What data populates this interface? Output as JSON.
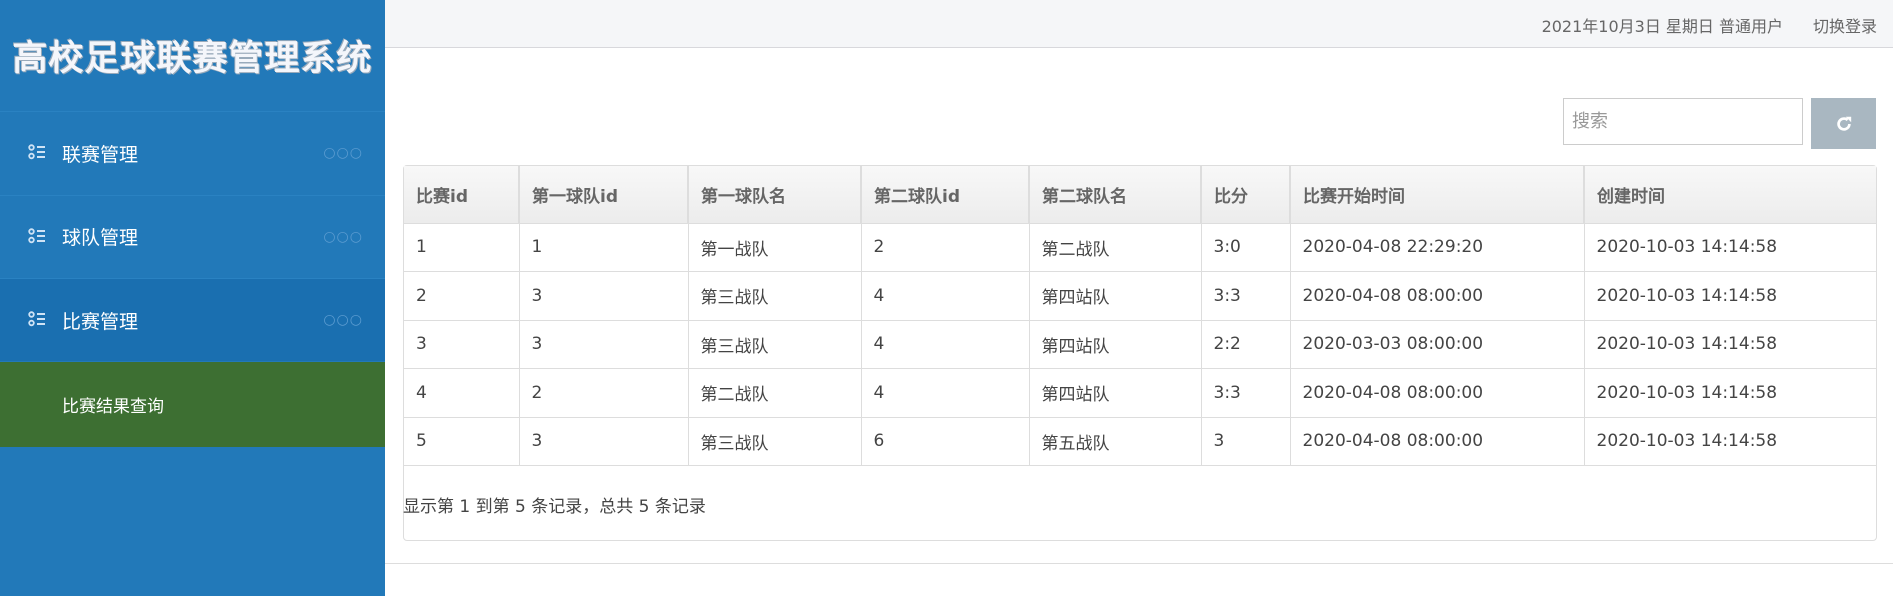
{
  "sidebar": {
    "title": "高校足球联赛管理系统",
    "items": [
      {
        "label": "联赛管理",
        "more": "○○○"
      },
      {
        "label": "球队管理",
        "more": "○○○"
      },
      {
        "label": "比赛管理",
        "more": "○○○"
      }
    ],
    "subitem": "比赛结果查询"
  },
  "header": {
    "info": "2021年10月3日 星期日 普通用户",
    "switch": "切换登录"
  },
  "toolbar": {
    "search_placeholder": "搜索",
    "refresh_icon": "refresh-icon"
  },
  "table": {
    "columns": [
      "比赛id",
      "第一球队id",
      "第一球队名",
      "第二球队id",
      "第二球队名",
      "比分",
      "比赛开始时间",
      "创建时间"
    ],
    "rows": [
      [
        "1",
        "1",
        "第一战队",
        "2",
        "第二战队",
        "3:0",
        "2020-04-08 22:29:20",
        "2020-10-03 14:14:58"
      ],
      [
        "2",
        "3",
        "第三战队",
        "4",
        "第四站队",
        "3:3",
        "2020-04-08 08:00:00",
        "2020-10-03 14:14:58"
      ],
      [
        "3",
        "3",
        "第三战队",
        "4",
        "第四站队",
        "2:2",
        "2020-03-03 08:00:00",
        "2020-10-03 14:14:58"
      ],
      [
        "4",
        "2",
        "第二战队",
        "4",
        "第四站队",
        "3:3",
        "2020-04-08 08:00:00",
        "2020-10-03 14:14:58"
      ],
      [
        "5",
        "3",
        "第三战队",
        "6",
        "第五战队",
        "3",
        "2020-04-08 08:00:00",
        "2020-10-03 14:14:58"
      ]
    ]
  },
  "pagination": {
    "summary": "显示第 1 到第 5 条记录，总共 5 条记录"
  },
  "colors": {
    "sidebar": "#2279b9",
    "active": "#3d6f32",
    "button": "#a9b7c1"
  }
}
